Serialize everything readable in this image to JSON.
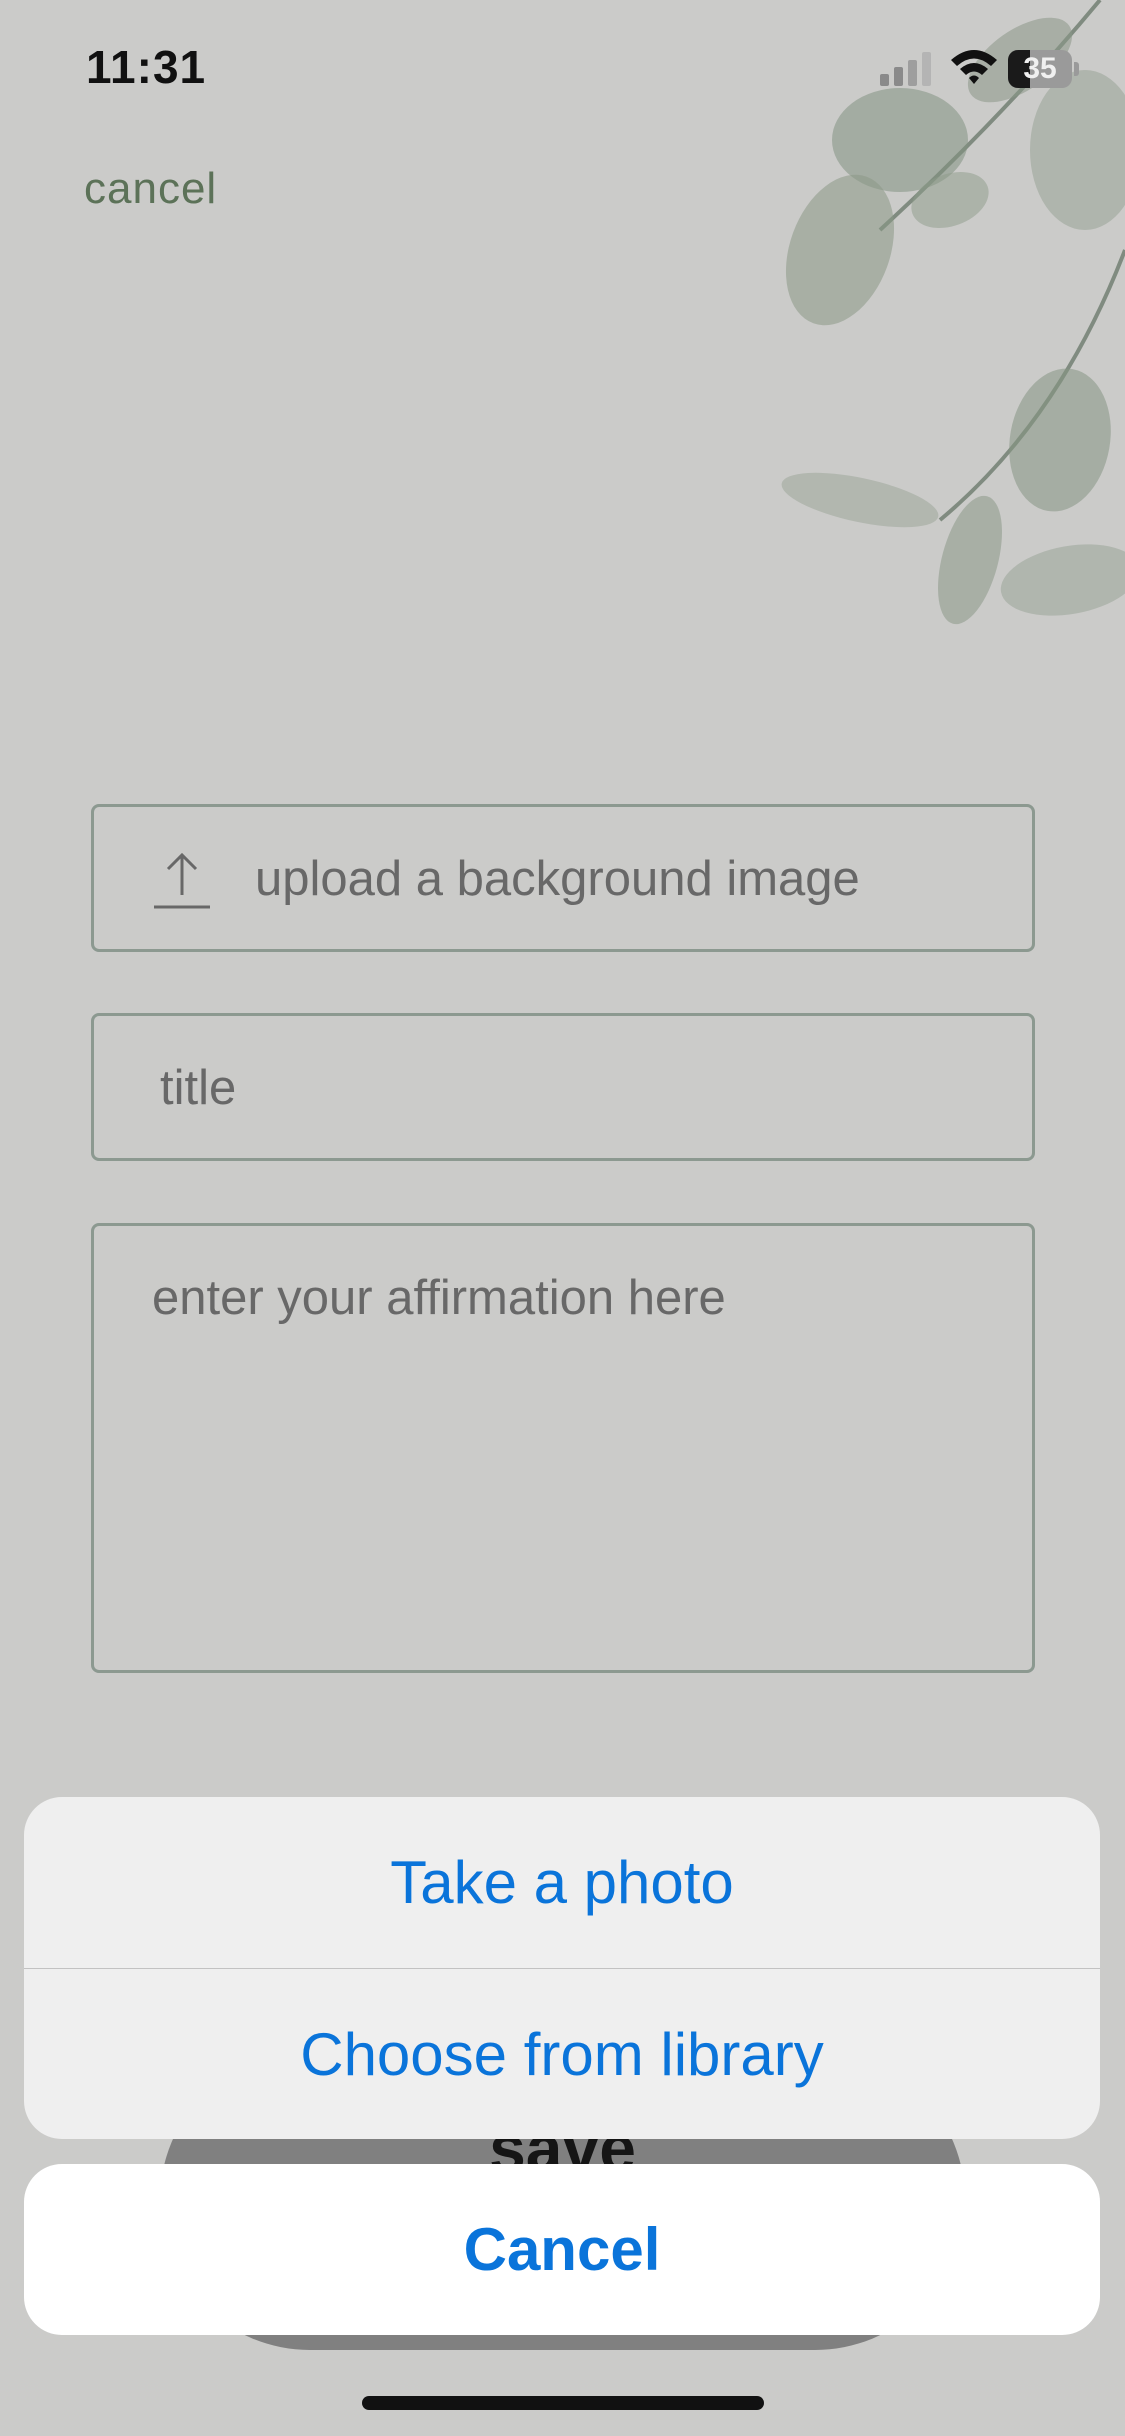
{
  "status_bar": {
    "time": "11:31",
    "battery_level": "35",
    "battery_fraction": 0.35,
    "icons": [
      "signal-icon",
      "wifi-icon",
      "battery-icon"
    ]
  },
  "header": {
    "cancel_label": "cancel"
  },
  "form": {
    "upload_label": "upload a background image",
    "title_placeholder": "title",
    "affirmation_placeholder": "enter your affirmation here"
  },
  "save": {
    "label": "save"
  },
  "action_sheet": {
    "options": [
      {
        "label": "Take a photo"
      },
      {
        "label": "Choose from library"
      }
    ],
    "cancel_label": "Cancel"
  },
  "colors": {
    "action_blue": "#0a74da",
    "sage_green": "#6f8a6a",
    "field_border": "#a9b8ae"
  }
}
